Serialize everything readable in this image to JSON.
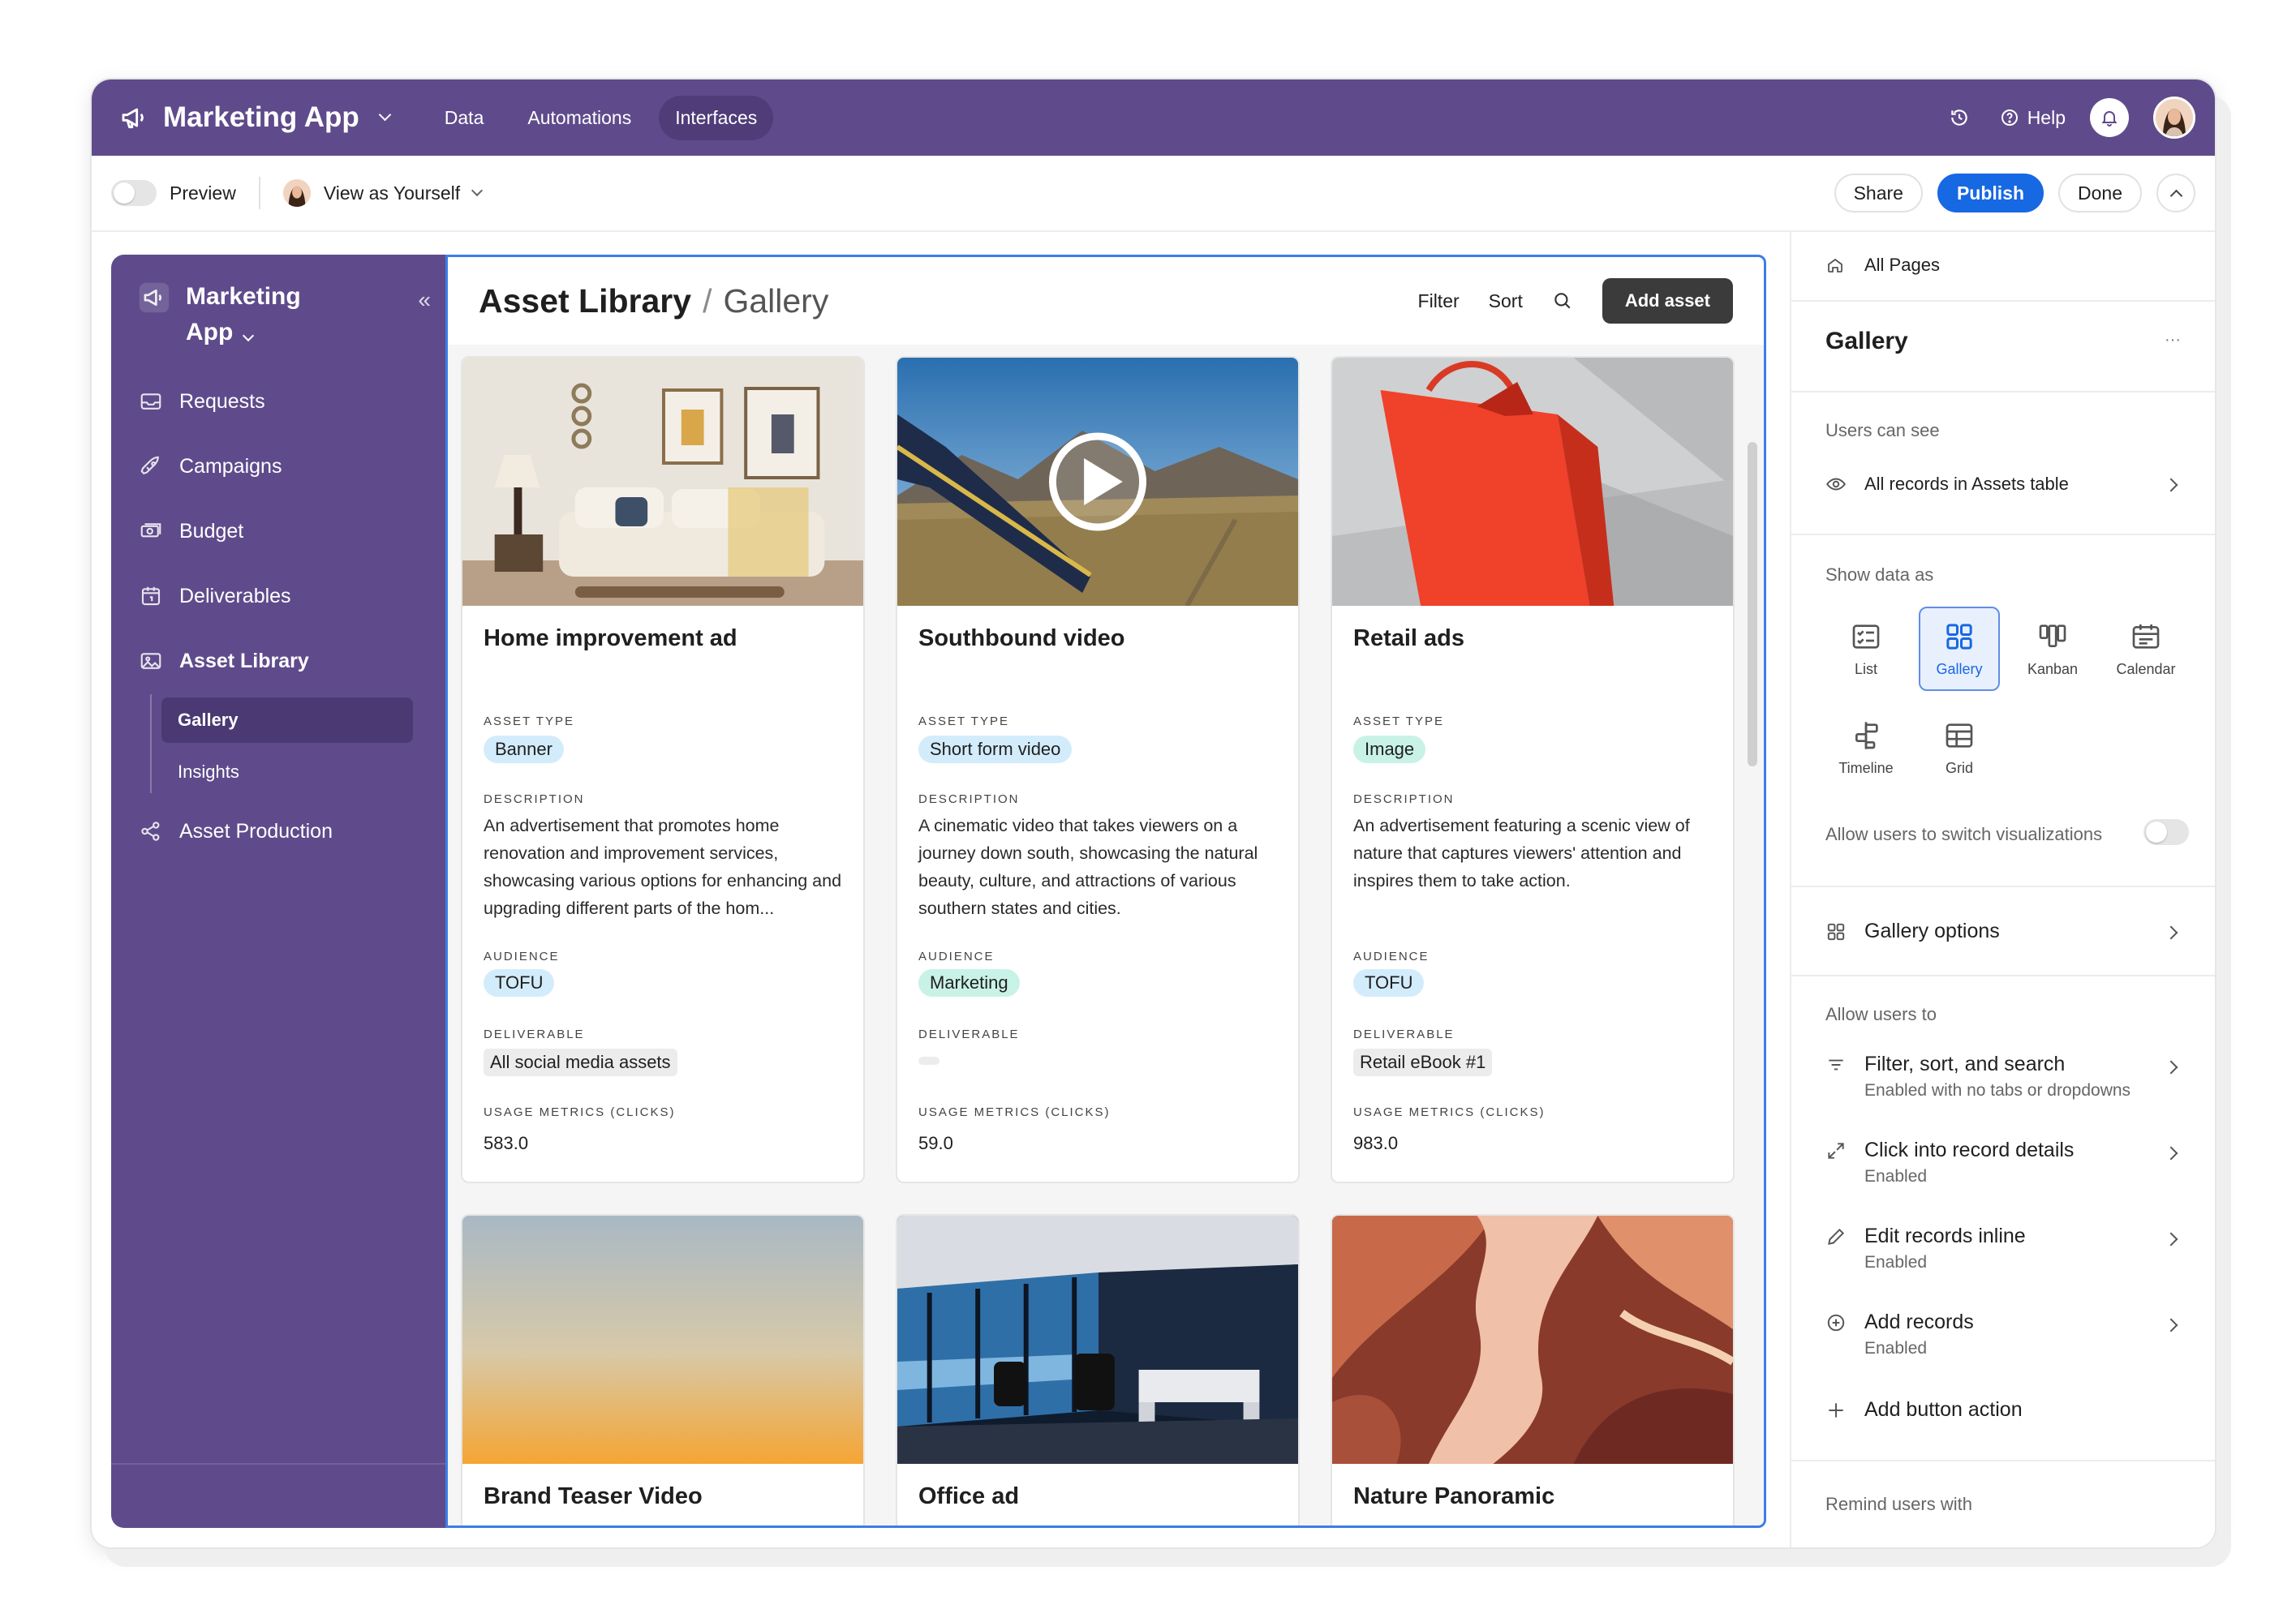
{
  "topbar": {
    "app_title": "Marketing App",
    "tabs": [
      {
        "label": "Data"
      },
      {
        "label": "Automations"
      },
      {
        "label": "Interfaces"
      }
    ],
    "help_label": "Help"
  },
  "subbar": {
    "preview_label": "Preview",
    "view_as_label": "View as Yourself",
    "share_label": "Share",
    "publish_label": "Publish",
    "done_label": "Done"
  },
  "sidebar": {
    "title": "Marketing App",
    "items": [
      {
        "label": "Requests",
        "icon": "inbox-icon"
      },
      {
        "label": "Campaigns",
        "icon": "rocket-icon"
      },
      {
        "label": "Budget",
        "icon": "money-icon"
      },
      {
        "label": "Deliverables",
        "icon": "calendar-icon"
      },
      {
        "label": "Asset Library",
        "icon": "image-icon"
      },
      {
        "label": "Asset Production",
        "icon": "nodes-icon"
      }
    ],
    "subitems": [
      {
        "label": "Gallery"
      },
      {
        "label": "Insights"
      }
    ]
  },
  "main": {
    "breadcrumb_parent": "Asset Library",
    "breadcrumb_sep": "/",
    "breadcrumb_current": "Gallery",
    "filter_label": "Filter",
    "sort_label": "Sort",
    "add_label": "Add asset",
    "field_labels": {
      "asset_type": "ASSET TYPE",
      "description": "DESCRIPTION",
      "audience": "AUDIENCE",
      "deliverable": "DELIVERABLE",
      "usage": "USAGE METRICS (CLICKS)"
    },
    "cards": [
      {
        "title": "Home improvement ad",
        "asset_type": "Banner",
        "description": "An advertisement that promotes home renovation and improvement services, showcasing various options for enhancing and upgrading different parts of the hom...",
        "audience": "TOFU",
        "deliverable": "All social media assets",
        "usage": "583.0"
      },
      {
        "title": "Southbound video",
        "asset_type": "Short form video",
        "description": "A cinematic video that takes viewers on a journey down south, showcasing the natural beauty, culture, and attractions of various southern states and cities.",
        "audience": "Marketing",
        "deliverable": "",
        "usage": "59.0"
      },
      {
        "title": "Retail ads",
        "asset_type": "Image",
        "description": "An advertisement featuring a scenic view of nature that captures viewers' attention and inspires them to take action.",
        "audience": "TOFU",
        "deliverable": "Retail eBook #1",
        "usage": "983.0"
      },
      {
        "title": "Brand Teaser Video"
      },
      {
        "title": "Office ad"
      },
      {
        "title": "Nature Panoramic"
      }
    ]
  },
  "panel": {
    "all_pages_label": "All Pages",
    "page_title": "Gallery",
    "more_label": "···",
    "users_can_see_label": "Users can see",
    "records_label": "All records in Assets table",
    "show_data_as_label": "Show data as",
    "visualizations": [
      {
        "label": "List"
      },
      {
        "label": "Gallery"
      },
      {
        "label": "Kanban"
      },
      {
        "label": "Calendar"
      },
      {
        "label": "Timeline"
      },
      {
        "label": "Grid"
      }
    ],
    "allow_switch_label": "Allow users to switch visualizations",
    "gallery_options_label": "Gallery options",
    "allow_users_to_label": "Allow users to",
    "options": [
      {
        "title": "Filter, sort, and search",
        "sub": "Enabled with no tabs or dropdowns"
      },
      {
        "title": "Click into record details",
        "sub": "Enabled"
      },
      {
        "title": "Edit records inline",
        "sub": "Enabled"
      },
      {
        "title": "Add records",
        "sub": "Enabled"
      }
    ],
    "add_button_action_label": "Add button action",
    "remind_label": "Remind users with"
  },
  "colors": {
    "brand_purple": "#5f4b8b",
    "publish_blue": "#1768e3",
    "tag_blue": "#d3ecfb",
    "tag_teal": "#c9f2e6"
  }
}
